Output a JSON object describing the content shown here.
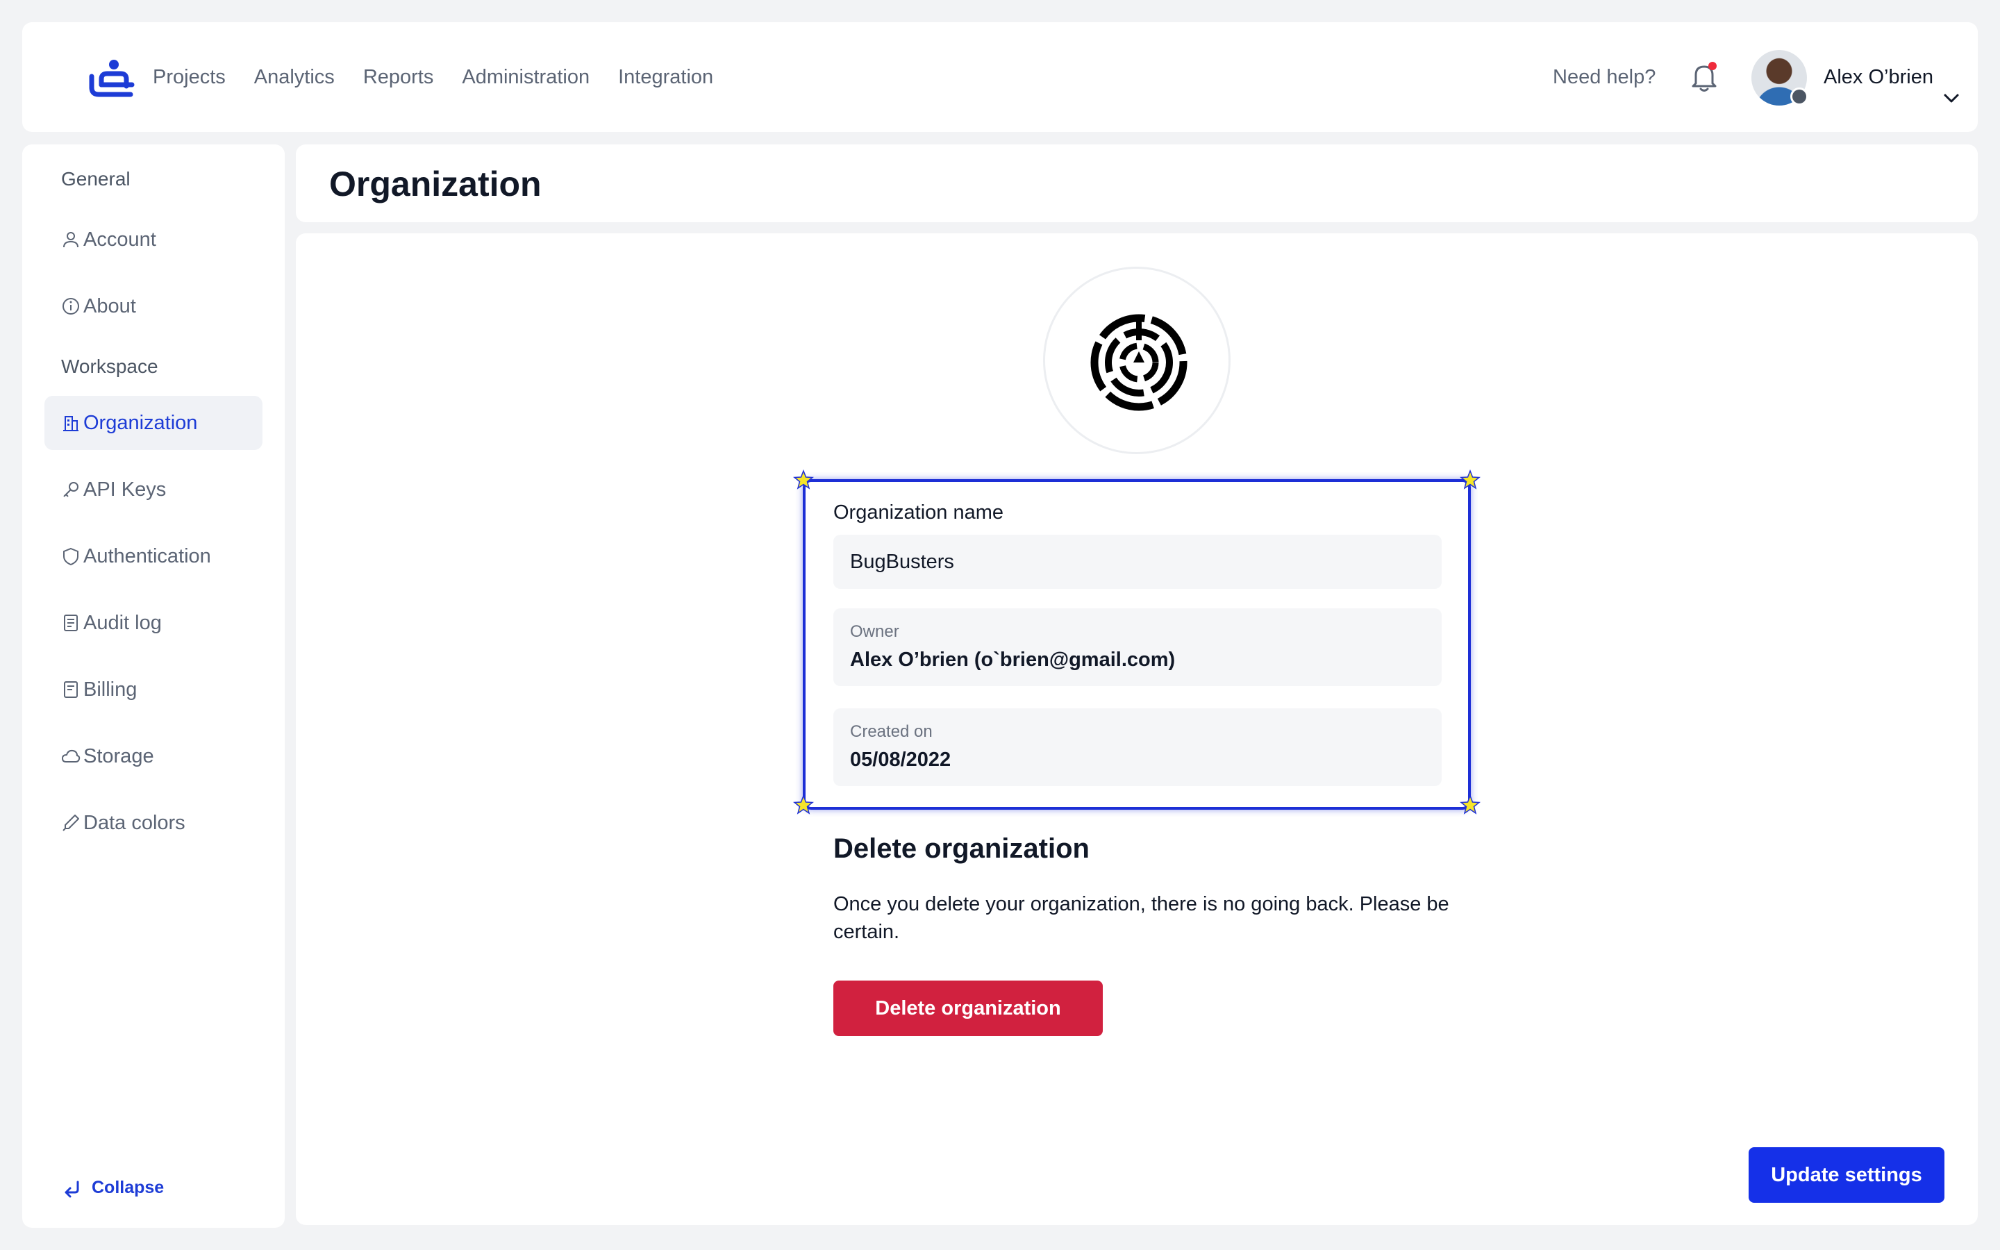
{
  "header": {
    "nav": [
      "Projects",
      "Analytics",
      "Reports",
      "Administration",
      "Integration"
    ],
    "help": "Need help?",
    "user_name": "Alex O’brien",
    "notification_dot_color": "#ef2b3b",
    "icons": {
      "logo": "app-logo-icon",
      "bell": "bell-icon",
      "chevron": "chevron-down-icon"
    }
  },
  "sidebar": {
    "section_general": "General",
    "section_workspace": "Workspace",
    "items": [
      {
        "label": "Account",
        "icon": "user-icon"
      },
      {
        "label": "About",
        "icon": "info-icon"
      },
      {
        "label": "Organization",
        "icon": "building-icon",
        "active": true
      },
      {
        "label": "API Keys",
        "icon": "key-icon"
      },
      {
        "label": "Authentication",
        "icon": "shield-icon"
      },
      {
        "label": "Audit log",
        "icon": "document-list-icon"
      },
      {
        "label": "Billing",
        "icon": "receipt-icon"
      },
      {
        "label": "Storage",
        "icon": "cloud-icon"
      },
      {
        "label": "Data colors",
        "icon": "eyedropper-icon"
      }
    ],
    "collapse": "Collapse"
  },
  "page": {
    "title": "Organization",
    "org_name_label": "Organization name",
    "org_name_value": "BugBusters",
    "owner_label": "Owner",
    "owner_value": "Alex O’brien (o`brien@gmail.com)",
    "created_label": "Created on",
    "created_value": "05/08/2022",
    "delete_title": "Delete organization",
    "delete_text": "Once you delete your organization, there is no going back. Please be certain.",
    "delete_button": "Delete organization",
    "update_button": "Update settings"
  },
  "colors": {
    "accent": "#1d3cd6",
    "danger": "#d1213f",
    "primary_button": "#1530e8",
    "highlight_border": "#1d2fd6",
    "highlight_star": "#f5e52a"
  }
}
